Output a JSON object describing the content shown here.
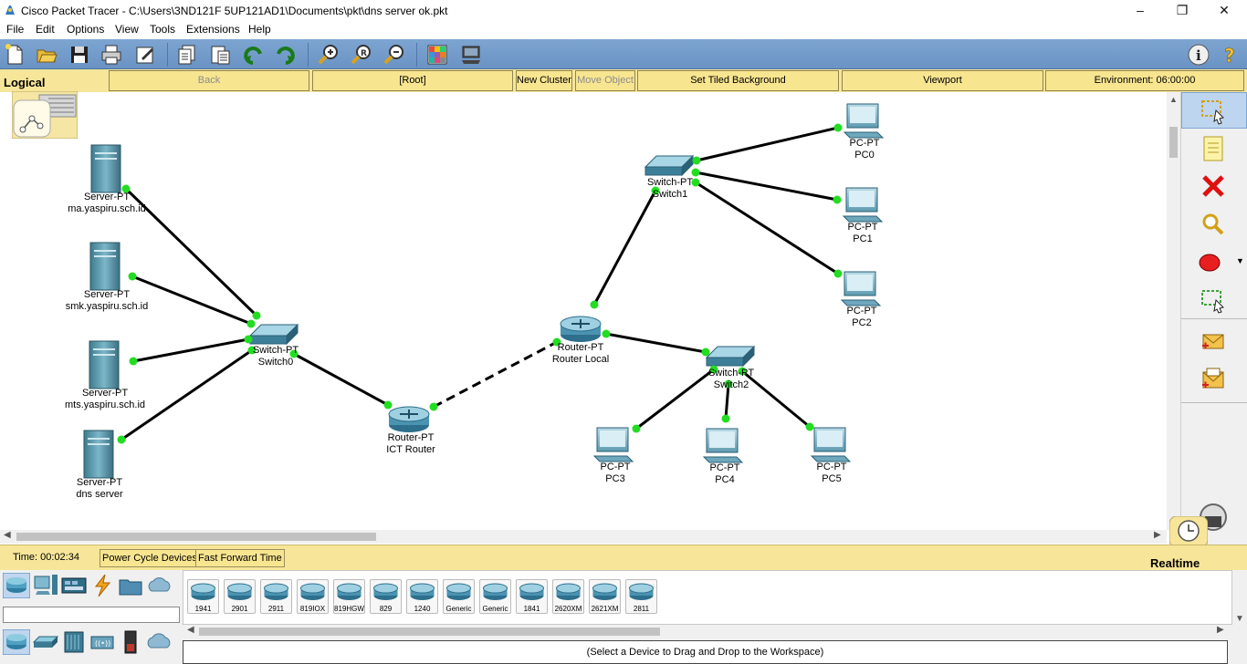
{
  "window": {
    "title": "Cisco Packet Tracer - C:\\Users\\3ND121F 5UP121AD1\\Documents\\pkt\\dns server ok.pkt",
    "controls": [
      "–",
      "❐",
      "✕"
    ]
  },
  "menu": [
    "File",
    "Edit",
    "Options",
    "View",
    "Tools",
    "Extensions",
    "Help"
  ],
  "toolbar": {
    "icons": [
      "new-file-icon",
      "open-folder-icon",
      "save-icon",
      "print-icon",
      "activity-wizard-icon",
      "copy-icon",
      "paste-icon",
      "undo-icon",
      "redo-icon",
      "zoom-in-icon",
      "zoom-reset-icon",
      "zoom-out-icon",
      "palette-icon",
      "custom-device-icon"
    ],
    "right_icons": [
      "info-icon",
      "help-icon"
    ]
  },
  "logical_bar": {
    "label": "Logical",
    "back": "Back",
    "root": "[Root]",
    "new_cluster": "New Cluster",
    "move_object": "Move Object",
    "set_tiled_background": "Set Tiled Background",
    "viewport": "Viewport",
    "environment": "Environment: 06:00:00"
  },
  "network": {
    "nodes": [
      {
        "id": "server-ma",
        "type": "Server-PT",
        "name": "ma.yaspiru.sch.id"
      },
      {
        "id": "server-smk",
        "type": "Server-PT",
        "name": "smk.yaspiru.sch.id"
      },
      {
        "id": "server-mts",
        "type": "Server-PT",
        "name": "mts.yaspiru.sch.id"
      },
      {
        "id": "server-dns",
        "type": "Server-PT",
        "name": "dns server"
      },
      {
        "id": "switch0",
        "type": "Switch-PT",
        "name": "Switch0"
      },
      {
        "id": "ict-router",
        "type": "Router-PT",
        "name": "ICT Router"
      },
      {
        "id": "router-local",
        "type": "Router-PT",
        "name": "Router Local"
      },
      {
        "id": "switch1",
        "type": "Switch-PT",
        "name": "Switch1"
      },
      {
        "id": "switch2",
        "type": "Switch-PT",
        "name": "Switch2"
      },
      {
        "id": "pc0",
        "type": "PC-PT",
        "name": "PC0"
      },
      {
        "id": "pc1",
        "type": "PC-PT",
        "name": "PC1"
      },
      {
        "id": "pc2",
        "type": "PC-PT",
        "name": "PC2"
      },
      {
        "id": "pc3",
        "type": "PC-PT",
        "name": "PC3"
      },
      {
        "id": "pc4",
        "type": "PC-PT",
        "name": "PC4"
      },
      {
        "id": "pc5",
        "type": "PC-PT",
        "name": "PC5"
      }
    ],
    "links": [
      {
        "from": "server-ma",
        "to": "switch0",
        "style": "solid"
      },
      {
        "from": "server-smk",
        "to": "switch0",
        "style": "solid"
      },
      {
        "from": "server-mts",
        "to": "switch0",
        "style": "solid"
      },
      {
        "from": "server-dns",
        "to": "switch0",
        "style": "solid"
      },
      {
        "from": "switch0",
        "to": "ict-router",
        "style": "solid"
      },
      {
        "from": "ict-router",
        "to": "router-local",
        "style": "dashed"
      },
      {
        "from": "router-local",
        "to": "switch1",
        "style": "solid"
      },
      {
        "from": "router-local",
        "to": "switch2",
        "style": "solid"
      },
      {
        "from": "switch1",
        "to": "pc0",
        "style": "solid"
      },
      {
        "from": "switch1",
        "to": "pc1",
        "style": "solid"
      },
      {
        "from": "switch1",
        "to": "pc2",
        "style": "solid"
      },
      {
        "from": "switch2",
        "to": "pc3",
        "style": "solid"
      },
      {
        "from": "switch2",
        "to": "pc4",
        "style": "solid"
      },
      {
        "from": "switch2",
        "to": "pc5",
        "style": "solid"
      }
    ],
    "link_light_color": "#22dd22"
  },
  "right_tools": [
    "select-icon",
    "note-icon",
    "delete-icon",
    "inspect-icon",
    "draw-ellipse-icon",
    "resize-icon",
    "add-simple-pdu-icon",
    "add-complex-pdu-icon"
  ],
  "status": {
    "time": "Time: 00:02:34",
    "power_cycle": "Power Cycle Devices",
    "fast_forward": "Fast Forward Time",
    "mode": "Realtime"
  },
  "device_picker": {
    "categories_top": [
      "network-devices-icon",
      "end-devices-icon",
      "components-icon",
      "connections-icon",
      "miscellaneous-icon",
      "multiuser-icon"
    ],
    "categories_bottom": [
      "routers-icon",
      "switches-icon",
      "hubs-icon",
      "wireless-devices-icon",
      "security-icon",
      "wan-emulation-icon"
    ],
    "models": [
      "1941",
      "2901",
      "2911",
      "819IOX",
      "819HGW",
      "829",
      "1240",
      "Generic",
      "Generic",
      "1841",
      "2620XM",
      "2621XM",
      "2811"
    ],
    "hint": "(Select a Device to Drag and Drop to the Workspace)"
  }
}
